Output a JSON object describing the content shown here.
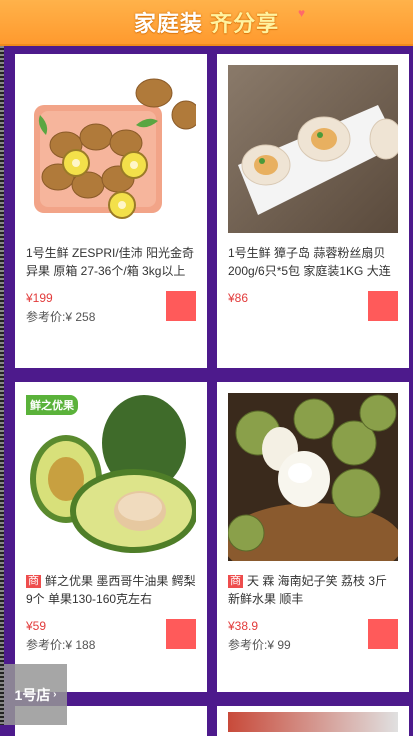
{
  "banner": {
    "title_part1": "家庭装",
    "title_part2": "齐分享"
  },
  "products": [
    {
      "title": "1号生鲜 ZESPRI/佳沛 阳光金奇异果 原箱 27-36个/箱 3kg以上",
      "tag": "",
      "price": "¥199",
      "ref_price": "参考价:¥ 258"
    },
    {
      "title": "1号生鲜 獐子岛 蒜蓉粉丝扇贝 200g/6只*5包 家庭装1KG 大连",
      "tag": "",
      "price": "¥86",
      "ref_price": ""
    },
    {
      "title": "鲜之优果 墨西哥牛油果 鳄梨9个 单果130-160克左右",
      "tag": "商",
      "price": "¥59",
      "ref_price": "参考价:¥ 188",
      "brand_label": "鲜之优果"
    },
    {
      "title": "天 霖 海南妃子笑 荔枝 3斤 新鲜水果 顺丰",
      "tag": "商",
      "price": "¥38.9",
      "ref_price": "参考价:¥ 99"
    }
  ],
  "floating_nav": {
    "label": "1号店"
  },
  "colors": {
    "background": "#4d1a8c",
    "banner": "#ff9a2e",
    "price": "#e23b3b",
    "cart_button": "#ff5a5a"
  }
}
